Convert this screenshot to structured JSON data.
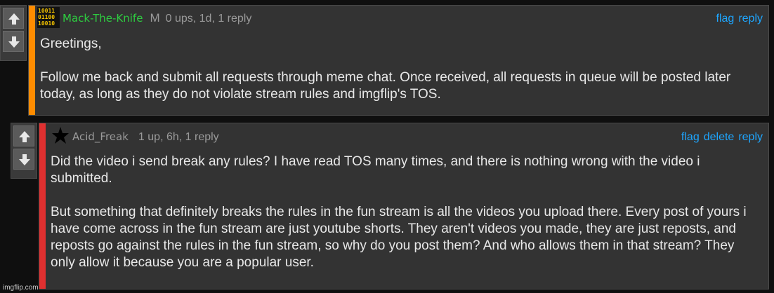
{
  "comments": [
    {
      "username": "Mack-The-Knife",
      "mod_badge": "M",
      "meta": "0 ups, 1d, 1 reply",
      "actions": [
        "flag",
        "reply"
      ],
      "avatar_icon": "binary-avatar-icon",
      "accent_color": "#ff8c00",
      "username_color": "#2ecc40",
      "body": [
        "Greetings,",
        "Follow me back and submit all requests through meme chat. Once received, all requests in queue will be posted later today, as long as they do not violate stream rules and imgflip's TOS."
      ]
    },
    {
      "username": "Acid_Freak",
      "meta": "1 up, 6h, 1 reply",
      "actions": [
        "flag",
        "delete",
        "reply"
      ],
      "avatar_icon": "star-icon",
      "accent_color": "#e03030",
      "username_color": "#9a9a9a",
      "body": [
        "Did the video i send break any rules? I have read TOS many times, and there is nothing wrong with the video i submitted.",
        "But something that definitely breaks the rules in the fun stream is all the videos you upload there. Every post of yours i have come across in the fun stream are just youtube shorts. They aren't videos you made, they are just reposts, and reposts go against the rules in the fun stream, so why do you post them? And who allows them in that stream? They only allow it because you are a popular user."
      ]
    }
  ],
  "watermark": "imgflip.com",
  "icons": {
    "upvote": "up-arrow-icon",
    "downvote": "down-arrow-icon"
  }
}
